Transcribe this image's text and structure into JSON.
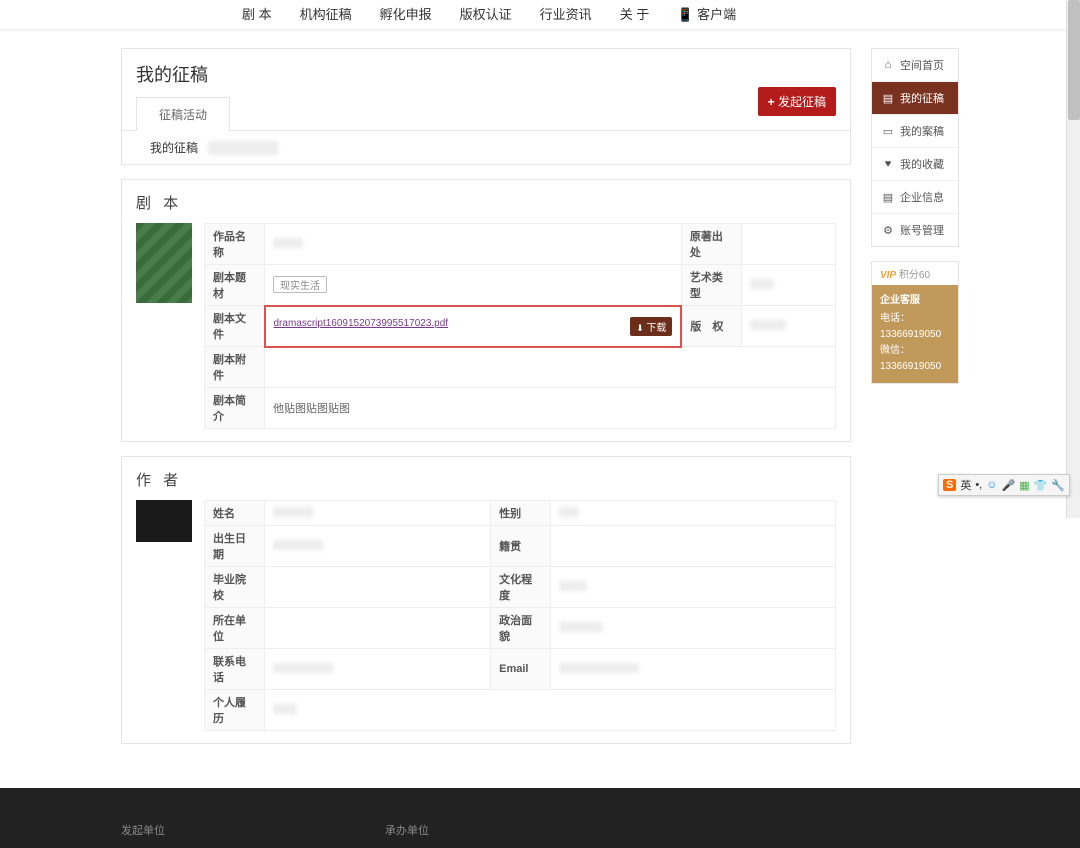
{
  "nav": {
    "items": [
      "剧 本",
      "机构征稿",
      "孵化申报",
      "版权认证",
      "行业资讯",
      "关 于",
      "📱 客户端"
    ]
  },
  "page": {
    "title": "我的征稿",
    "tab_active": "征稿活动",
    "launch_btn": "发起征稿",
    "my_drafts_label": "我的征稿"
  },
  "script_section": {
    "title": "剧 本",
    "rows": {
      "work_name_label": "作品名称",
      "source_label": "原著出处",
      "theme_label": "剧本题材",
      "theme_value": "现实生活",
      "art_type_label": "艺术类型",
      "file_label": "剧本文件",
      "file_name": "dramascript1609152073995517023.pdf",
      "download_btn": "下载",
      "copyright_label": "版　权",
      "attach_label": "剧本附件",
      "intro_label": "剧本简介",
      "intro_value": "他贴图贴图贴图"
    }
  },
  "author_section": {
    "title": "作 者",
    "rows": {
      "name_label": "姓名",
      "gender_label": "性别",
      "birth_label": "出生日期",
      "nationality_label": "籍贯",
      "school_label": "毕业院校",
      "school_value": "",
      "edu_label": "文化程度",
      "unit_label": "所在单位",
      "politics_label": "政治面貌",
      "phone_label": "联系电话",
      "email_label": "Email",
      "resume_label": "个人履历"
    }
  },
  "sidemenu": {
    "items": [
      {
        "icon": "⌂",
        "label": "空间首页"
      },
      {
        "icon": "▤",
        "label": "我的征稿"
      },
      {
        "icon": "▭",
        "label": "我的案稿"
      },
      {
        "icon": "♥",
        "label": "我的收藏"
      },
      {
        "icon": "▤",
        "label": "企业信息"
      },
      {
        "icon": "⚙",
        "label": "账号管理"
      }
    ],
    "active_index": 1
  },
  "vip": {
    "tag": "VIP",
    "points": "积分60",
    "title": "企业客服",
    "phone_label": "电话：",
    "phone": "13366919050",
    "wechat_label": "微信：",
    "wechat": "13366919050"
  },
  "footer": {
    "left": "发起单位",
    "right": "承办单位"
  },
  "ime": {
    "brand": "S",
    "lang": "英",
    "punct": "•,"
  }
}
